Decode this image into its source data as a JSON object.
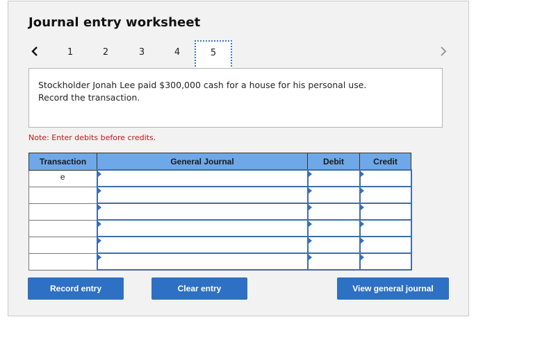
{
  "worksheet": {
    "title": "Journal entry worksheet",
    "nav": {
      "prev_icon": "chevron-left-icon",
      "next_icon": "chevron-right-icon",
      "tabs": [
        "1",
        "2",
        "3",
        "4",
        "5"
      ],
      "active_tab": "5"
    },
    "question": {
      "line1": "Stockholder Jonah Lee paid $300,000 cash for a house for his personal use.",
      "line2": "Record the transaction."
    },
    "note": "Note: Enter debits before credits.",
    "table": {
      "headers": [
        "Transaction",
        "General Journal",
        "Debit",
        "Credit"
      ],
      "rows": [
        {
          "transaction": "e",
          "account": "",
          "debit": "",
          "credit": ""
        },
        {
          "transaction": "",
          "account": "",
          "debit": "",
          "credit": ""
        },
        {
          "transaction": "",
          "account": "",
          "debit": "",
          "credit": ""
        },
        {
          "transaction": "",
          "account": "",
          "debit": "",
          "credit": ""
        },
        {
          "transaction": "",
          "account": "",
          "debit": "",
          "credit": ""
        },
        {
          "transaction": "",
          "account": "",
          "debit": "",
          "credit": ""
        }
      ]
    },
    "buttons": {
      "record": "Record entry",
      "clear": "Clear entry",
      "view": "View general journal"
    },
    "colors": {
      "header_bg": "#6fa8e8",
      "button_bg": "#2e70c3",
      "note_text": "#c0161b",
      "input_border": "#3e6ca8"
    }
  }
}
